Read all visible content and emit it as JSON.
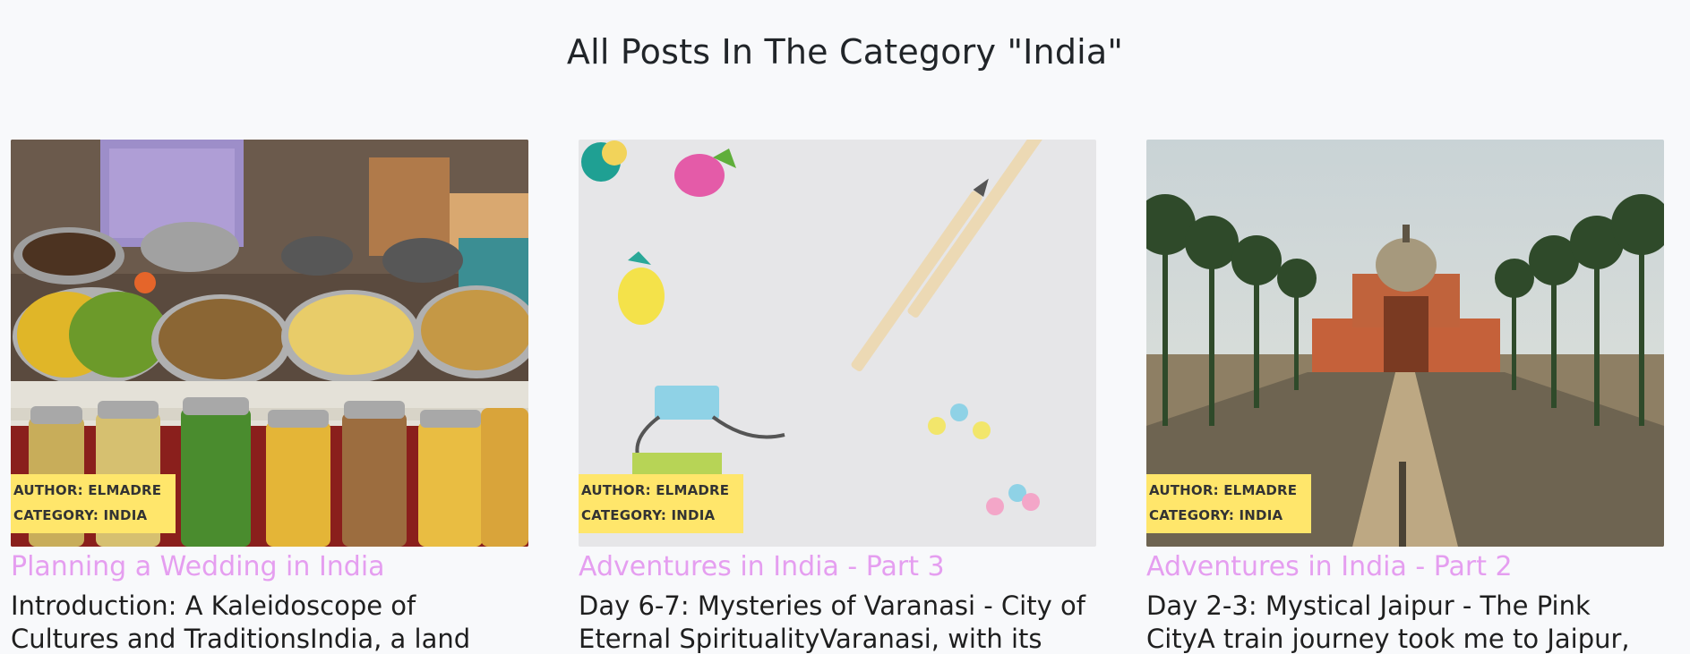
{
  "header": {
    "title": "All Posts In The Category \"India\""
  },
  "posts": [
    {
      "image_desc": "market stall spices",
      "author": "AUTHOR: ELMADRE",
      "category": "CATEGORY: INDIA",
      "title": "Planning a Wedding in India",
      "excerpt": "Introduction: A Kaleidoscope of Cultures and TraditionsIndia, a land"
    },
    {
      "image_desc": "stationery flat lay",
      "author": "AUTHOR: ELMADRE",
      "category": "CATEGORY: INDIA",
      "title": "Adventures in India - Part 3",
      "excerpt": "Day 6-7: Mysteries of Varanasi - City of Eternal SpiritualityVaranasi, with its"
    },
    {
      "image_desc": "tomb with palm avenue",
      "author": "AUTHOR: ELMADRE",
      "category": "CATEGORY: INDIA",
      "title": "Adventures in India - Part 2",
      "excerpt": "Day 2-3: Mystical Jaipur - The Pink CityA train journey took me to Jaipur,"
    }
  ],
  "colors": {
    "background": "#f8f9fb",
    "badge": "#ffe66b",
    "post_title": "#e59ef0"
  }
}
